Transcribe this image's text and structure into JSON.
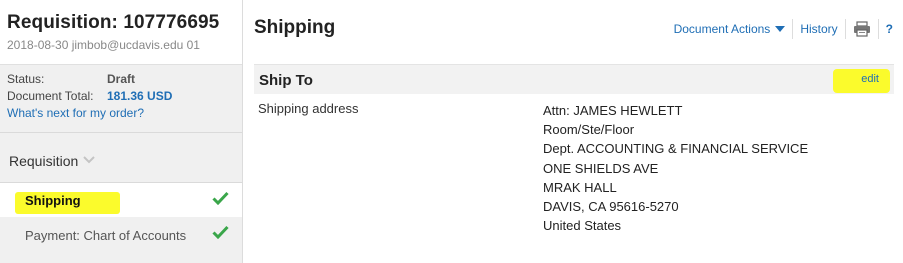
{
  "requisition": {
    "title": "Requisition: 107776695",
    "subtitle": "2018-08-30 jimbob@ucdavis.edu 01"
  },
  "status": {
    "status_label": "Status:",
    "status_value": "Draft",
    "total_label": "Document Total:",
    "total_value": "181.36 USD",
    "whats_next": "What's next for my order?"
  },
  "nav": {
    "section_label": "Requisition",
    "items": [
      {
        "label": "Shipping",
        "active": true,
        "complete": true
      },
      {
        "label": "Payment: Chart of Accounts",
        "active": false,
        "complete": true
      }
    ]
  },
  "header": {
    "page_title": "Shipping",
    "document_actions": "Document Actions",
    "history": "History",
    "help": "?"
  },
  "ship_to": {
    "section_title": "Ship To",
    "edit_label": "edit",
    "field_label": "Shipping address",
    "address_lines": [
      "Attn: JAMES HEWLETT",
      "Room/Ste/Floor",
      "Dept. ACCOUNTING & FINANCIAL SERVICE",
      "ONE SHIELDS AVE",
      "MRAK HALL",
      "DAVIS, CA 95616-5270",
      "United States"
    ]
  },
  "colors": {
    "link": "#1f6eb5",
    "check": "#3aa64a",
    "highlight": "#fbfb2c",
    "sidebar_bg": "#f0f0f0"
  },
  "icons": {
    "check": "check-icon",
    "print": "print-icon",
    "chevron": "chevron-down-icon",
    "caret": "caret-down-icon"
  }
}
